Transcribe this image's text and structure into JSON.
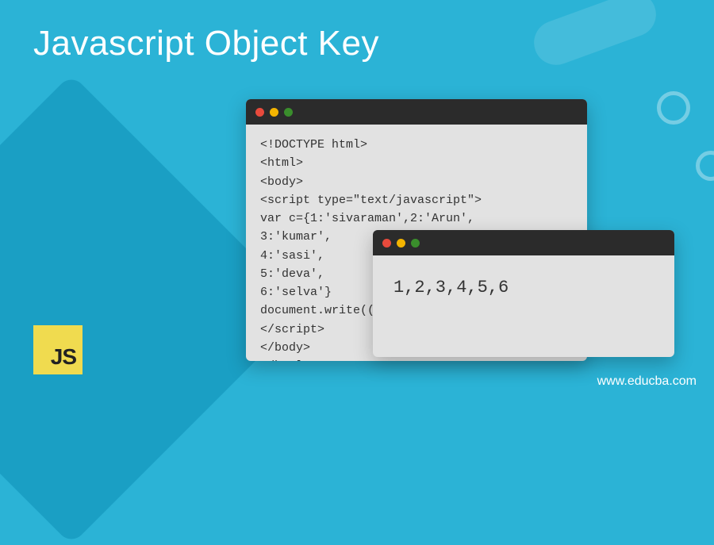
{
  "title": "Javascript Object Key",
  "code_window": {
    "lines": "<!DOCTYPE html>\n<html>\n<body>\n<script type=\"text/javascript\">\nvar c={1:'sivaraman',2:'Arun',\n3:'kumar',\n4:'sasi',\n5:'deva',\n6:'selva'}\ndocument.write((\n</script>\n</body>\n</html>"
  },
  "output_window": {
    "text": "1,2,3,4,5,6"
  },
  "logo": {
    "label": "JS"
  },
  "footer": {
    "url": "www.educba.com"
  }
}
